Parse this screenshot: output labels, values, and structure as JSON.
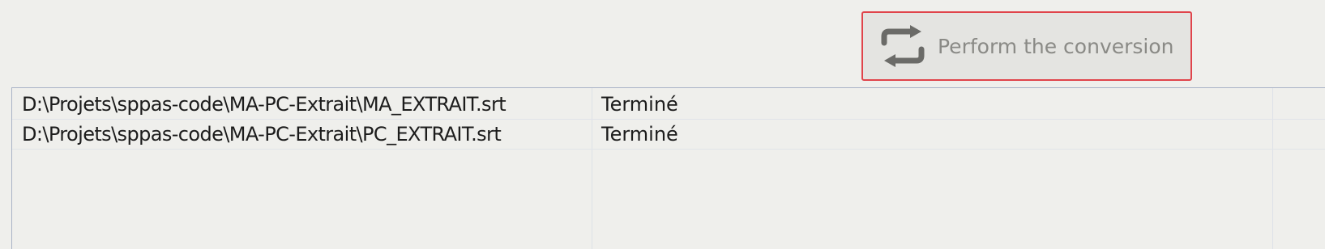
{
  "toolbar": {
    "convert_label": "Perform the conversion",
    "convert_icon": "sync-arrows-icon"
  },
  "file_list": {
    "rows": [
      {
        "path": "D:\\Projets\\sppas-code\\MA-PC-Extrait\\MA_EXTRAIT.srt",
        "status": "Terminé"
      },
      {
        "path": "D:\\Projets\\sppas-code\\MA-PC-Extrait\\PC_EXTRAIT.srt",
        "status": "Terminé"
      }
    ]
  },
  "colors": {
    "background": "#efefec",
    "button_border": "#e0444b",
    "button_text": "#8a8a86",
    "list_border": "#a9b3c7"
  }
}
